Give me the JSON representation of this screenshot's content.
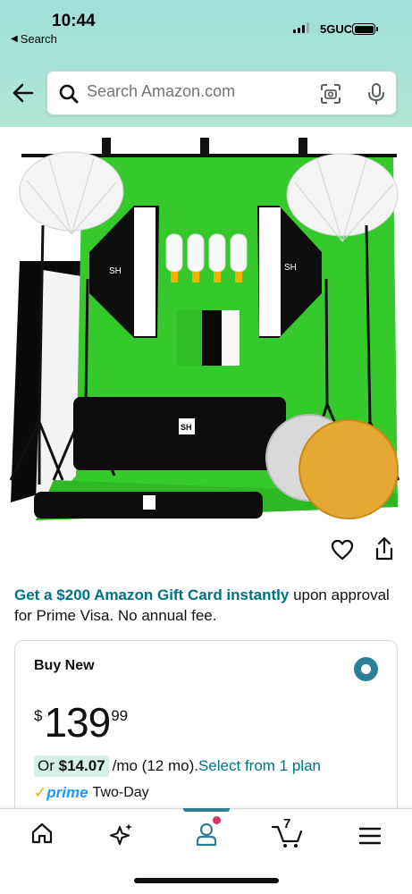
{
  "status_bar": {
    "time": "10:44",
    "back_label": "Search",
    "network": "5GUC"
  },
  "search": {
    "placeholder": "Search Amazon.com"
  },
  "product_image": {
    "brand_mark": "SH",
    "brand_subtext": "SH"
  },
  "promo": {
    "link_text": "Get a $200 Amazon Gift Card instantly",
    "rest_text": " upon approval for Prime Visa. No annual fee."
  },
  "buy_box": {
    "title": "Buy New",
    "price_currency": "$",
    "price_whole": "139",
    "price_fraction": "99",
    "monthly_prefix": "Or ",
    "monthly_amount": "$14.07",
    "monthly_terms": " /mo (12 mo). ",
    "plan_link": "Select from 1 plan",
    "prime_check": "✓",
    "prime_word": "prime",
    "prime_delivery": "Two-Day"
  },
  "bottom_nav": {
    "items": [
      "home-icon",
      "sparkle-icon",
      "account-icon",
      "cart-icon",
      "menu-icon"
    ],
    "cart_count": "7"
  },
  "colors": {
    "link": "#007185",
    "accent_teal": "#2b7f96",
    "backdrop_green": "#36c92b",
    "prime_blue": "#1a98ff",
    "prime_check": "#f0a30a"
  }
}
